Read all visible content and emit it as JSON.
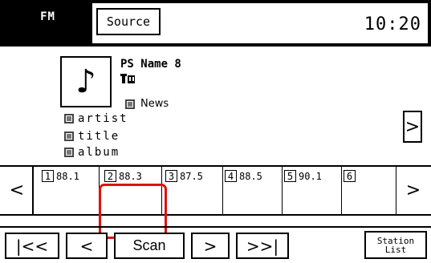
{
  "header": {
    "mode": "FM",
    "source_button": "Source",
    "clock": "10:20"
  },
  "now_playing": {
    "album_art_icon": "music-note-icon",
    "ps_name": "PS Name 8",
    "pty_label": "News",
    "artist": "artist",
    "title": "title",
    "album": "album"
  },
  "presets": [
    {
      "number": "1",
      "frequency": "88.1"
    },
    {
      "number": "2",
      "frequency": "88.3"
    },
    {
      "number": "3",
      "frequency": "87.5"
    },
    {
      "number": "4",
      "frequency": "88.5"
    },
    {
      "number": "5",
      "frequency": "90.1"
    },
    {
      "number": "6",
      "frequency": ""
    }
  ],
  "controls": {
    "seek_back": "|<<",
    "tune_down": "<",
    "scan": "Scan",
    "tune_up": ">",
    "seek_forward": ">>|",
    "station_list_line1": "Station",
    "station_list_line2": "List"
  },
  "icons": {
    "page_right": ">",
    "presets_left": "<",
    "presets_right": ">"
  }
}
